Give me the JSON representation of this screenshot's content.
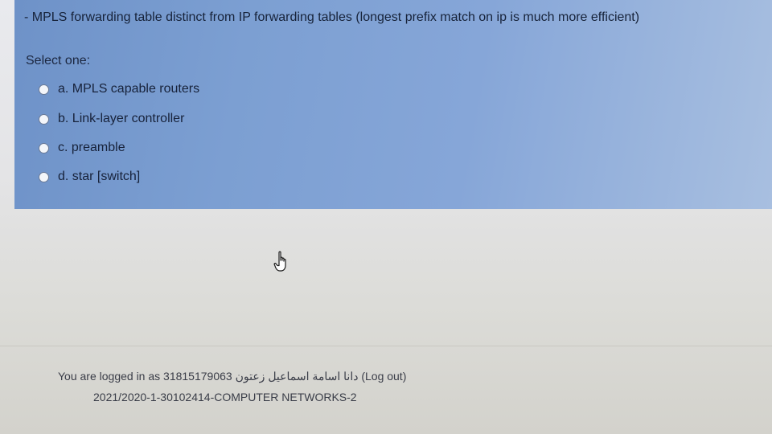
{
  "question": {
    "text": "- MPLS forwarding table distinct from IP forwarding tables (longest prefix match on ip is much more efficient)",
    "prompt": "Select one:",
    "options": [
      {
        "label": "a. MPLS capable routers"
      },
      {
        "label": "b. Link-layer controller"
      },
      {
        "label": "c. preamble"
      },
      {
        "label": "d. star [switch]"
      }
    ]
  },
  "footer": {
    "logged_in_prefix": "You are logged in as 31815179063",
    "user_name": "دانا اسامة اسماعيل زعتون",
    "logout_label": "(Log out)",
    "course": "2021/2020-1-30102414-COMPUTER NETWORKS-2"
  },
  "colors": {
    "question_bg": "#7c9fd2",
    "page_bg": "#e4e4e6"
  },
  "icons": {
    "cursor": "hand-pointer-icon",
    "option_marker": "radio-button"
  }
}
